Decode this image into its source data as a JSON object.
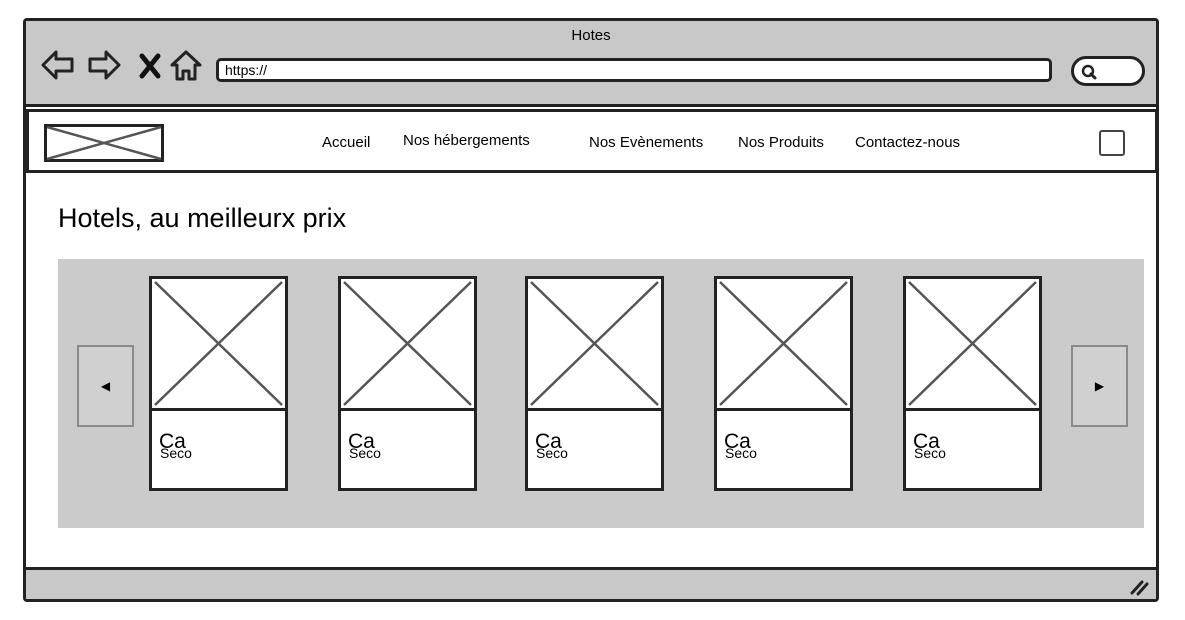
{
  "browser": {
    "title": "Hotes",
    "url": "https://",
    "icons": [
      "back-icon",
      "forward-icon",
      "close-icon",
      "home-icon",
      "search-icon"
    ]
  },
  "nav": {
    "items": [
      {
        "label": "Accueil"
      },
      {
        "label": "Nos hébergements"
      },
      {
        "label": "Nos Evènements"
      },
      {
        "label": "Nos Produits"
      },
      {
        "label": "Contactez-nous"
      }
    ]
  },
  "main": {
    "headline": "Hotels, au meilleurx prix",
    "cards": [
      {
        "caption": "Ca",
        "subcaption": "Seco"
      },
      {
        "caption": "Ca",
        "subcaption": "Seco"
      },
      {
        "caption": "Ca",
        "subcaption": "Seco"
      },
      {
        "caption": "Ca",
        "subcaption": "Seco"
      },
      {
        "caption": "Ca",
        "subcaption": "Seco"
      }
    ]
  },
  "colors": {
    "chrome": "#c8c8c8",
    "carousel": "#cbcbcb",
    "stroke": "#222222",
    "placeholder_x": "#555555"
  }
}
